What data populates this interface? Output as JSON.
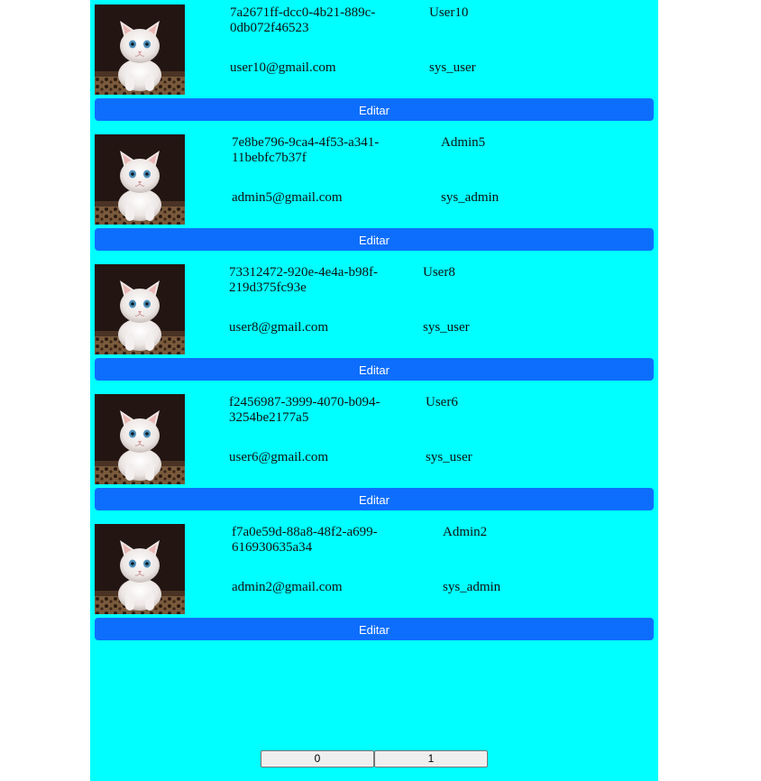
{
  "users": [
    {
      "id": "7a2671ff-dcc0-4b21-889c-0db072f46523",
      "name": "User10",
      "email": "user10@gmail.com",
      "role": "sys_user",
      "edit_label": "Editar"
    },
    {
      "id": "7e8be796-9ca4-4f53-a341-11bebfc7b37f",
      "name": "Admin5",
      "email": "admin5@gmail.com",
      "role": "sys_admin",
      "edit_label": "Editar"
    },
    {
      "id": "73312472-920e-4e4a-b98f-219d375fc93e",
      "name": "User8",
      "email": "user8@gmail.com",
      "role": "sys_user",
      "edit_label": "Editar"
    },
    {
      "id": "f2456987-3999-4070-b094-3254be2177a5",
      "name": "User6",
      "email": "user6@gmail.com",
      "role": "sys_user",
      "edit_label": "Editar"
    },
    {
      "id": "f7a0e59d-88a8-48f2-a699-616930635a34",
      "name": "Admin2",
      "email": "admin2@gmail.com",
      "role": "sys_admin",
      "edit_label": "Editar"
    }
  ],
  "pagination": {
    "pages": [
      "0",
      "1"
    ]
  },
  "colors": {
    "panel_bg": "#00ffff",
    "button_bg": "#0d6efd",
    "button_text": "#ffffff"
  }
}
